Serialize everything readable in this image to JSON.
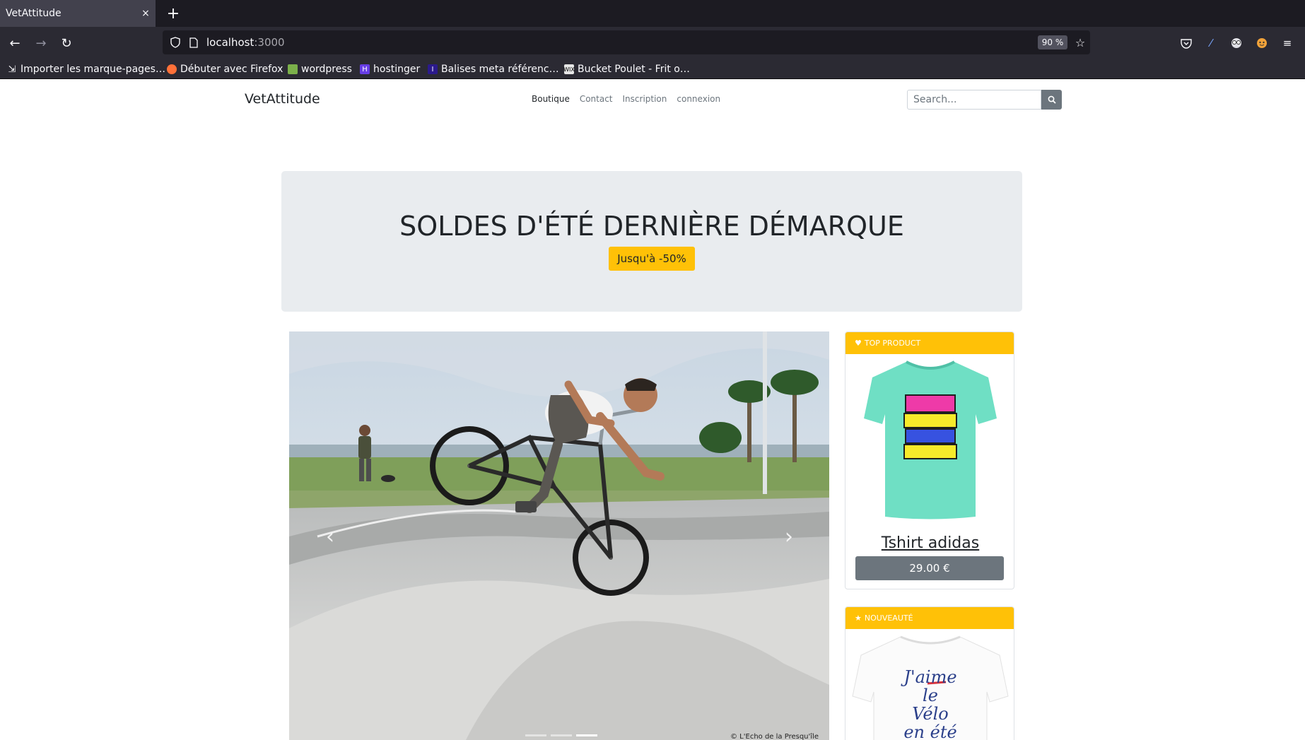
{
  "browser": {
    "tab_title": "VetAttitude",
    "tab_close": "×",
    "new_tab": "+",
    "url_host": "localhost",
    "url_port": ":3000",
    "zoom": "90 %",
    "bookmarks": [
      "Importer les marque-pages…",
      "Débuter avec Firefox",
      "wordpress",
      "hostinger",
      "Balises meta référenc…",
      "Bucket Poulet - Frit o…"
    ]
  },
  "site": {
    "brand": "VetAttitude",
    "nav": [
      "Boutique",
      "Contact",
      "Inscription",
      "connexion"
    ],
    "search_placeholder": "Search..."
  },
  "hero": {
    "title": "SOLDES D'ÉTÉ DERNIÈRE DÉMARQUE",
    "badge": "Jusqu'à -50%"
  },
  "carousel": {
    "credit": "© L'Echo de la Presqu'île",
    "active_index": 2
  },
  "cards": [
    {
      "header": "TOP PRODUCT",
      "icon": "heart-icon",
      "title": "Tshirt adidas",
      "price": "29.00 €"
    },
    {
      "header": "NOUVEAUTÉ",
      "icon": "star-icon",
      "shirt_text": [
        "J'aime",
        "le",
        "Vélo",
        "en été"
      ]
    }
  ],
  "colors": {
    "accent": "#ffc107",
    "secondary": "#6c757d",
    "hero_bg": "#e9ecef"
  }
}
